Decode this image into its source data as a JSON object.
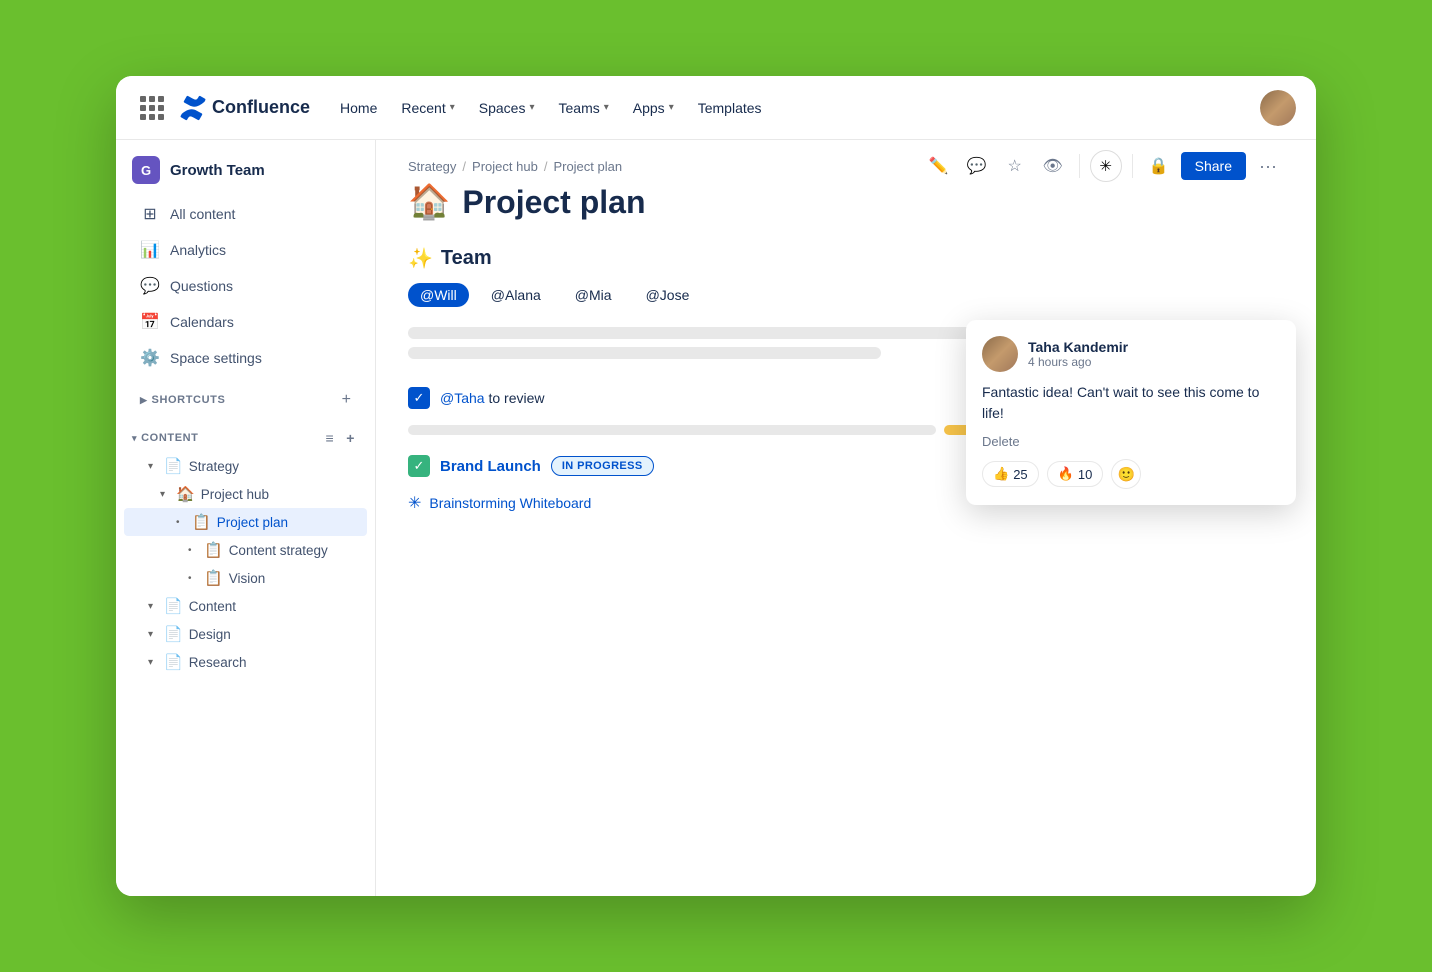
{
  "window": {
    "title": "Confluence"
  },
  "topnav": {
    "logo_text": "Confluence",
    "home_label": "Home",
    "recent_label": "Recent",
    "spaces_label": "Spaces",
    "teams_label": "Teams",
    "apps_label": "Apps",
    "templates_label": "Templates",
    "share_label": "Share"
  },
  "sidebar": {
    "space_name": "Growth Team",
    "space_initial": "G",
    "items": [
      {
        "id": "all-content",
        "icon": "⊞",
        "label": "All content"
      },
      {
        "id": "analytics",
        "icon": "📊",
        "label": "Analytics"
      },
      {
        "id": "questions",
        "icon": "💬",
        "label": "Questions"
      },
      {
        "id": "calendars",
        "icon": "📅",
        "label": "Calendars"
      },
      {
        "id": "space-settings",
        "icon": "⚙️",
        "label": "Space settings"
      }
    ],
    "shortcuts_label": "SHORTCUTS",
    "content_label": "CONTENT",
    "tree": [
      {
        "id": "strategy",
        "level": 1,
        "icon": "📄",
        "label": "Strategy",
        "toggle": "▾"
      },
      {
        "id": "project-hub",
        "level": 2,
        "icon": "🏠",
        "label": "Project hub",
        "toggle": "▾"
      },
      {
        "id": "project-plan",
        "level": 3,
        "icon": "📋",
        "label": "Project plan",
        "toggle": "•",
        "active": true
      },
      {
        "id": "content-strategy",
        "level": 4,
        "icon": "📋",
        "label": "Content strategy",
        "toggle": "•"
      },
      {
        "id": "vision",
        "level": 4,
        "icon": "📋",
        "label": "Vision",
        "toggle": "•"
      },
      {
        "id": "content",
        "level": 1,
        "icon": "📄",
        "label": "Content",
        "toggle": "▾"
      },
      {
        "id": "design",
        "level": 1,
        "icon": "📄",
        "label": "Design",
        "toggle": "▾"
      },
      {
        "id": "research",
        "level": 1,
        "icon": "📄",
        "label": "Research",
        "toggle": "▾"
      }
    ]
  },
  "breadcrumb": {
    "items": [
      "Strategy",
      "Project hub",
      "Project plan"
    ],
    "separator": "/"
  },
  "page": {
    "emoji": "🏠",
    "title": "Project plan",
    "team_section_emoji": "✨",
    "team_section_label": "Team",
    "team_members": [
      {
        "id": "will",
        "label": "@Will",
        "active": true
      },
      {
        "id": "alana",
        "label": "@Alana",
        "active": false
      },
      {
        "id": "mia",
        "label": "@Mia",
        "active": false
      },
      {
        "id": "jose",
        "label": "@Jose",
        "active": false
      }
    ],
    "content_lines": [
      {
        "id": "line1",
        "width": "72%"
      },
      {
        "id": "line2",
        "width": "54%"
      }
    ],
    "task_mention": "@Taha",
    "task_text": "to review",
    "progress_lines": [
      {
        "id": "gray1",
        "type": "gray",
        "width": "38%"
      },
      {
        "id": "yellow1",
        "type": "yellow",
        "width": "22%"
      }
    ],
    "brand_launch_label": "Brand Launch",
    "brand_launch_status": "IN PROGRESS",
    "whiteboard_label": "Brainstorming Whiteboard"
  },
  "comment": {
    "author": "Taha Kandemir",
    "time": "4 hours ago",
    "body": "Fantastic idea! Can't wait to see this come to life!",
    "delete_label": "Delete",
    "reactions": [
      {
        "id": "thumbs-up",
        "emoji": "👍",
        "count": "25"
      },
      {
        "id": "fire",
        "emoji": "🔥",
        "count": "10"
      }
    ]
  }
}
